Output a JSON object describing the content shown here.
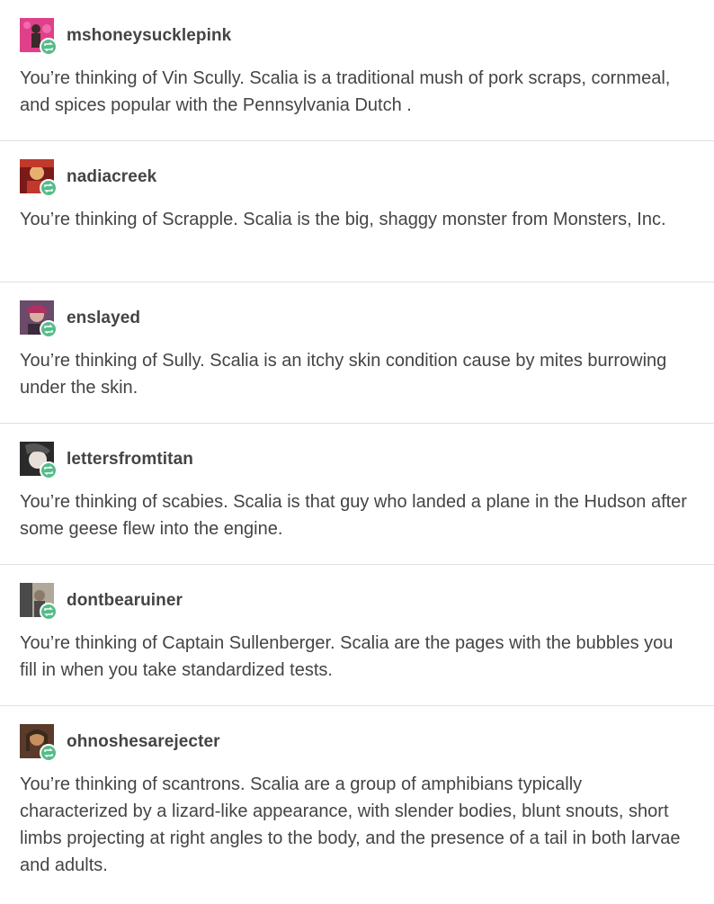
{
  "posts": [
    {
      "username": "mshoneysucklepink",
      "text": "You’re thinking of Vin Scully. Scalia is a traditional mush of pork scraps, cornmeal, and spices popular with the Pennsylvania Dutch .",
      "avatar_colors": [
        "#e0408a",
        "#f06bb0",
        "#3a2a2a"
      ]
    },
    {
      "username": "nadiacreek",
      "text": "You’re thinking of Scrapple. Scalia is the big, shaggy monster from Monsters, Inc.",
      "avatar_colors": [
        "#7a1a1a",
        "#c0392b",
        "#e8b070"
      ]
    },
    {
      "username": "enslayed",
      "text": "You’re thinking of Sully. Scalia is an itchy skin condition cause by mites burrowing under the skin.",
      "avatar_colors": [
        "#6b4a6a",
        "#b03060",
        "#d9b0a0"
      ]
    },
    {
      "username": "lettersfromtitan",
      "text": "You’re thinking of scabies. Scalia is that guy who landed a plane in the Hudson after some geese flew into the engine.",
      "avatar_colors": [
        "#2a2a2a",
        "#e8e0d8",
        "#555555"
      ]
    },
    {
      "username": "dontbearuiner",
      "text": "You’re thinking of Captain Sullenberger. Scalia are the pages with the bubbles you fill in when you take standardized tests.",
      "avatar_colors": [
        "#4a4a4a",
        "#8a7a6a",
        "#b0a898"
      ]
    },
    {
      "username": "ohnoshesarejecter",
      "text": "You’re thinking of scantrons. Scalia are a group of amphibians typically characterized by a lizard-like appearance, with slender bodies, blunt snouts, short limbs projecting at right angles to the body, and the presence of a tail in both larvae and adults.",
      "avatar_colors": [
        "#5a3a2a",
        "#c89060",
        "#3a2a1a"
      ]
    }
  ],
  "badge_color": "#56bc8a",
  "badge_icon": "reblog-icon"
}
